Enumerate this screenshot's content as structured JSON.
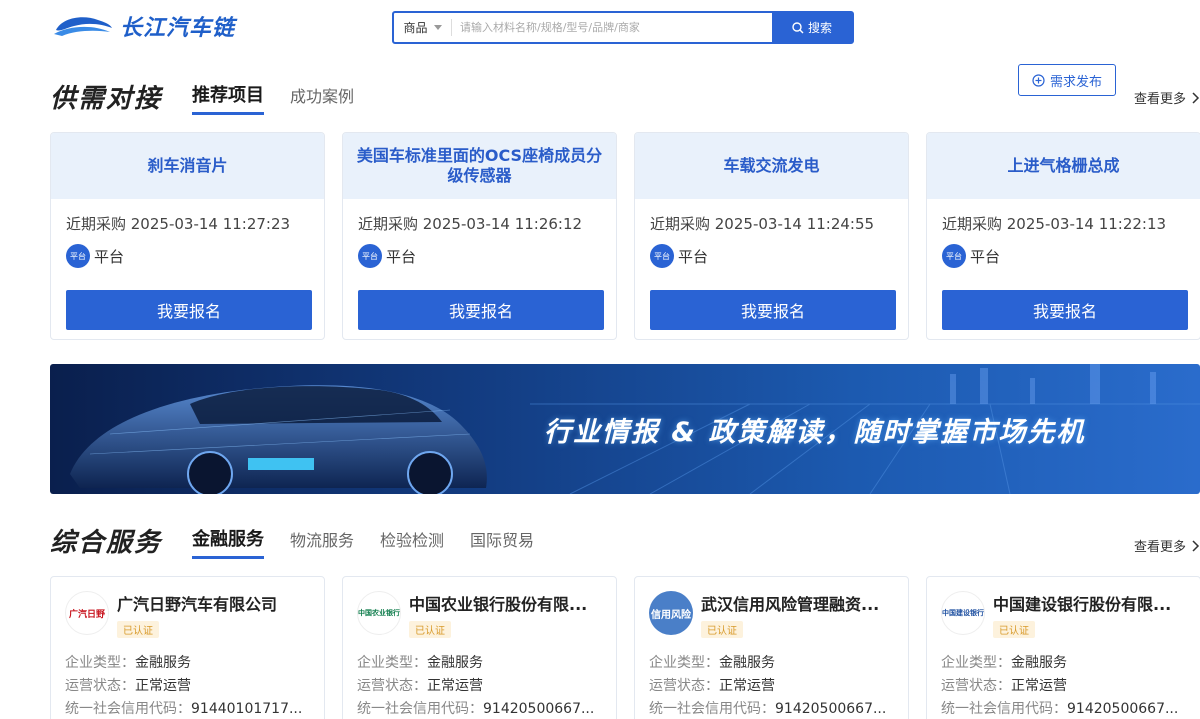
{
  "header": {
    "logo_text": "长江汽车链",
    "search": {
      "category": "商品",
      "placeholder": "请输入材料名称/规格/型号/品牌/商家",
      "button_label": "搜索"
    }
  },
  "supply": {
    "title": "供需对接",
    "tabs": [
      {
        "label": "推荐项目",
        "active": true
      },
      {
        "label": "成功案例",
        "active": false
      }
    ],
    "publish_label": "需求发布",
    "more_label": "查看更多",
    "cards": [
      {
        "title": "刹车消音片",
        "date": "近期采购 2025-03-14 11:27:23",
        "badge": "平台",
        "platform": "平台",
        "button": "我要报名"
      },
      {
        "title": "美国车标准里面的OCS座椅成员分级传感器",
        "date": "近期采购 2025-03-14 11:26:12",
        "badge": "平台",
        "platform": "平台",
        "button": "我要报名"
      },
      {
        "title": "车载交流发电",
        "date": "近期采购 2025-03-14 11:24:55",
        "badge": "平台",
        "platform": "平台",
        "button": "我要报名"
      },
      {
        "title": "上进气格栅总成",
        "date": "近期采购 2025-03-14 11:22:13",
        "badge": "平台",
        "platform": "平台",
        "button": "我要报名"
      }
    ]
  },
  "banner": {
    "text": "行业情报 & 政策解读，随时掌握市场先机"
  },
  "services": {
    "title": "综合服务",
    "tabs": [
      {
        "label": "金融服务",
        "active": true
      },
      {
        "label": "物流服务",
        "active": false
      },
      {
        "label": "检验检测",
        "active": false
      },
      {
        "label": "国际贸易",
        "active": false
      }
    ],
    "more_label": "查看更多",
    "cards": [
      {
        "name": "广汽日野汽车有限公司",
        "logo_text": "广汽日野",
        "cert": "已认证",
        "type_k": "企业类型：",
        "type_v": "金融服务",
        "status_k": "运营状态：",
        "status_v": "正常运营",
        "code_k": "统一社会信用代码：",
        "code_v": "91440101717..."
      },
      {
        "name": "中国农业银行股份有限...",
        "logo_text": "中国农业银行",
        "cert": "已认证",
        "type_k": "企业类型：",
        "type_v": "金融服务",
        "status_k": "运营状态：",
        "status_v": "正常运营",
        "code_k": "统一社会信用代码：",
        "code_v": "91420500667..."
      },
      {
        "name": "武汉信用风险管理融资...",
        "logo_text": "信用风险",
        "cert": "已认证",
        "type_k": "企业类型：",
        "type_v": "金融服务",
        "status_k": "运营状态：",
        "status_v": "正常运营",
        "code_k": "统一社会信用代码：",
        "code_v": "91420500667..."
      },
      {
        "name": "中国建设银行股份有限...",
        "logo_text": "中国建设银行",
        "cert": "已认证",
        "type_k": "企业类型：",
        "type_v": "金融服务",
        "status_k": "运营状态：",
        "status_v": "正常运营",
        "code_k": "统一社会信用代码：",
        "code_v": "91420500667..."
      }
    ]
  },
  "colors": {
    "primary": "#2a63d4",
    "card_top": "#e9f1fb",
    "cert_text": "#d89a2a"
  }
}
